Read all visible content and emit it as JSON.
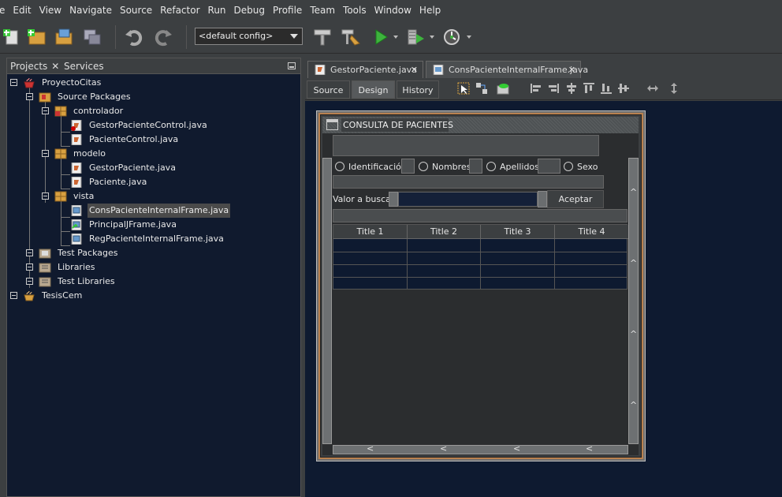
{
  "menu": [
    "e",
    "Edit",
    "View",
    "Navigate",
    "Source",
    "Refactor",
    "Run",
    "Debug",
    "Profile",
    "Team",
    "Tools",
    "Window",
    "Help"
  ],
  "toolbar": {
    "config": "<default config>"
  },
  "left_panel": {
    "tabs": {
      "projects": "Projects",
      "services": "Services",
      "close": "✕"
    },
    "tree": [
      "ProyectoCitas",
      "Source Packages",
      "controlador",
      "GestorPacienteControl.java",
      "PacienteControl.java",
      "modelo",
      "GestorPaciente.java",
      "Paciente.java",
      "vista",
      "ConsPacienteInternalFrame.java",
      "PrincipalJFrame.java",
      "RegPacienteInternalFrame.java",
      "Test Packages",
      "Libraries",
      "Test Libraries",
      "TesisCem"
    ]
  },
  "editor": {
    "tabs": [
      "GestorPaciente.java",
      "ConsPacienteInternalFrame.java"
    ],
    "close": "✕",
    "views": [
      "Source",
      "Design",
      "History"
    ]
  },
  "form": {
    "title": "CONSULTA DE PACIENTES",
    "radios": [
      "Identificación",
      "Nombres",
      "Apellidos",
      "Sexo"
    ],
    "search_label": "Valor a buscar",
    "search_value": "",
    "accept_label": "Aceptar",
    "table_headers": [
      "Title 1",
      "Title 2",
      "Title 3",
      "Title 4"
    ],
    "scroll_glyph_up": "^",
    "scroll_glyph_left": "<"
  }
}
